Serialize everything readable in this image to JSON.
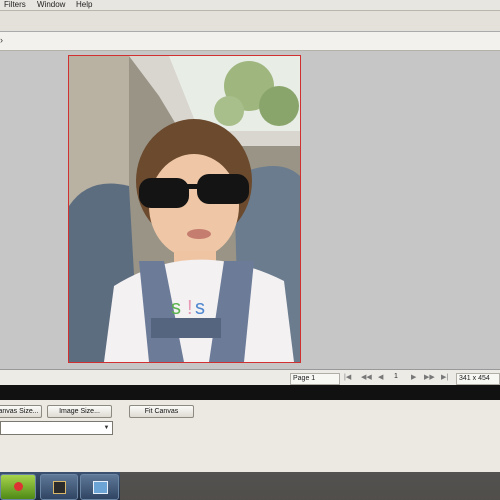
{
  "menu": {
    "items": [
      "Filters",
      "Window",
      "Help"
    ]
  },
  "status": {
    "page_label": "Page 1",
    "page_number": "1",
    "dimensions": "341 x 454"
  },
  "panel": {
    "buttons": [
      "Canvas Size...",
      "Image Size...",
      "Fit Canvas"
    ]
  },
  "icons": {
    "nav_first": "first-page-icon",
    "nav_prev": "previous-page-icon",
    "nav_next": "next-page-icon",
    "nav_last": "last-page-icon"
  }
}
